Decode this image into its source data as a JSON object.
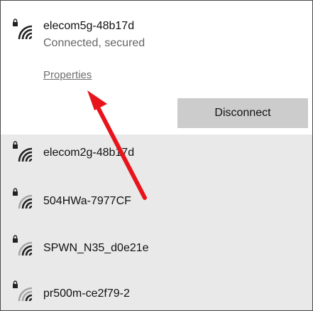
{
  "connected_network": {
    "name": "elecom5g-48b17d",
    "status": "Connected, secured",
    "properties_label": "Properties",
    "disconnect_label": "Disconnect"
  },
  "networks": [
    {
      "name": "elecom2g-48b17d",
      "icon": "wifi-secured-icon"
    },
    {
      "name": "504HWa-7977CF",
      "icon": "wifi-secured-icon"
    },
    {
      "name": "SPWN_N35_d0e21e",
      "icon": "wifi-secured-icon"
    },
    {
      "name": "pr500m-ce2f79-2",
      "icon": "wifi-secured-icon"
    }
  ],
  "colors": {
    "annotation_arrow": "#e8141b",
    "connected_panel_bg": "#ffffff",
    "list_bg": "#e9e9e9",
    "button_bg": "#cccccc"
  }
}
